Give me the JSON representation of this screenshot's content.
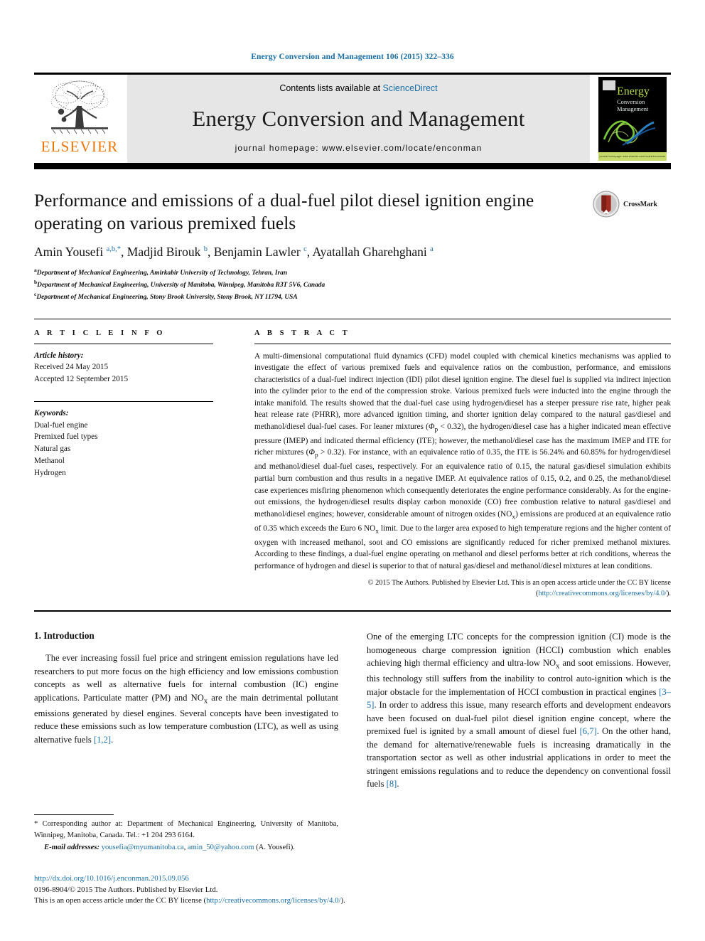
{
  "running_head": "Energy Conversion and Management 106 (2015) 322–336",
  "masthead": {
    "publisher_name": "ELSEVIER",
    "contents_prefix": "Contents lists available at ",
    "contents_link": "ScienceDirect",
    "journal_title": "Energy Conversion and Management",
    "homepage": "journal homepage: www.elsevier.com/locate/enconman",
    "cover": {
      "title": "Energy",
      "subtitle_line1": "Conversion",
      "subtitle_line2": "Management",
      "footer_strip": "journal homepage: www.elsevier.com/locate/enconman"
    }
  },
  "article": {
    "title": "Performance and emissions of a dual-fuel pilot diesel ignition engine operating on various premixed fuels",
    "crossmark_label": "CrossMark",
    "authors_html": "Amin Yousefi <sup>a,b,*</sup>, Madjid Birouk <sup>b</sup>, Benjamin Lawler <sup>c</sup>, Ayatallah Gharehghani <sup>a</sup>",
    "affiliations": [
      "Department of Mechanical Engineering, Amirkabir University of Technology, Tehran, Iran",
      "Department of Mechanical Engineering, University of Manitoba, Winnipeg, Manitoba R3T 5V6, Canada",
      "Department of Mechanical Engineering, Stony Brook University, Stony Brook, NY 11794, USA"
    ],
    "affiliation_marks": [
      "a",
      "b",
      "c"
    ]
  },
  "article_info": {
    "heading": "A R T I C L E    I N F O",
    "history_label": "Article history:",
    "history": [
      "Received 24 May 2015",
      "Accepted 12 September 2015"
    ],
    "keywords_label": "Keywords:",
    "keywords": [
      "Dual-fuel engine",
      "Premixed fuel types",
      "Natural gas",
      "Methanol",
      "Hydrogen"
    ]
  },
  "abstract": {
    "heading": "A B S T R A C T",
    "text": "A multi-dimensional computational fluid dynamics (CFD) model coupled with chemical kinetics mechanisms was applied to investigate the effect of various premixed fuels and equivalence ratios on the combustion, performance, and emissions characteristics of a dual-fuel indirect injection (IDI) pilot diesel ignition engine. The diesel fuel is supplied via indirect injection into the cylinder prior to the end of the compression stroke. Various premixed fuels were inducted into the engine through the intake manifold. The results showed that the dual-fuel case using hydrogen/diesel has a steeper pressure rise rate, higher peak heat release rate (PHRR), more advanced ignition timing, and shorter ignition delay compared to the natural gas/diesel and methanol/diesel dual-fuel cases. For leaner mixtures (Φp < 0.32), the hydrogen/diesel case has a higher indicated mean effective pressure (IMEP) and indicated thermal efficiency (ITE); however, the methanol/diesel case has the maximum IMEP and ITE for richer mixtures (Φp > 0.32). For instance, with an equivalence ratio of 0.35, the ITE is 56.24% and 60.85% for hydrogen/diesel and methanol/diesel dual-fuel cases, respectively. For an equivalence ratio of 0.15, the natural gas/diesel simulation exhibits partial burn combustion and thus results in a negative IMEP. At equivalence ratios of 0.15, 0.2, and 0.25, the methanol/diesel case experiences misfiring phenomenon which consequently deteriorates the engine performance considerably. As for the engine-out emissions, the hydrogen/diesel results display carbon monoxide (CO) free combustion relative to natural gas/diesel and methanol/diesel engines; however, considerable amount of nitrogen oxides (NOx) emissions are produced at an equivalence ratio of 0.35 which exceeds the Euro 6 NOx limit. Due to the larger area exposed to high temperature regions and the higher content of oxygen with increased methanol, soot and CO emissions are significantly reduced for richer premixed methanol mixtures. According to these findings, a dual-fuel engine operating on methanol and diesel performs better at rich conditions, whereas the performance of hydrogen and diesel is superior to that of natural gas/diesel and methanol/diesel mixtures at lean conditions.",
    "copyright_prefix": "© 2015 The Authors. Published by Elsevier Ltd. This is an open access article under the CC BY license (",
    "copyright_link": "http://creativecommons.org/licenses/by/4.0/",
    "copyright_suffix": ")."
  },
  "body": {
    "section_heading": "1. Introduction",
    "left_paragraph": "The ever increasing fossil fuel price and stringent emission regulations have led researchers to put more focus on the high efficiency and low emissions combustion concepts as well as alternative fuels for internal combustion (IC) engine applications. Particulate matter (PM) and NOx are the main detrimental pollutant emissions generated by diesel engines. Several concepts have been investigated to reduce these emissions such as low temperature combustion (LTC), as well as using alternative fuels",
    "left_ref": "[1,2]",
    "right_paragraph_1": "One of the emerging LTC concepts for the compression ignition (CI) mode is the homogeneous charge compression ignition (HCCI) combustion which enables achieving high thermal efficiency and ultra-low NOx and soot emissions. However, this technology still suffers from the inability to control auto-ignition which is the major obstacle for the implementation of HCCI combustion in practical engines",
    "right_ref_1": "[3–5]",
    "right_paragraph_2": ". In order to address this issue, many research efforts and development endeavors have been focused on dual-fuel pilot diesel ignition engine concept, where the premixed fuel is ignited by a small amount of diesel fuel",
    "right_ref_2": "[6,7]",
    "right_paragraph_3": ". On the other hand, the demand for alternative/renewable fuels is increasing dramatically in the transportation sector as well as other industrial applications in order to meet the stringent emissions regulations and to reduce the dependency on conventional fossil fuels",
    "right_ref_3": "[8]"
  },
  "footnote": {
    "star": "*",
    "corresponding": "Corresponding author at: Department of Mechanical Engineering, University of Manitoba, Winnipeg, Manitoba, Canada. Tel.: +1 204 293 6164.",
    "email_label": "E-mail addresses:",
    "email_1": "yousefia@myumanitoba.ca",
    "email_2": "amin_50@yahoo.com",
    "email_attrib": "(A. Yousefi)."
  },
  "footer": {
    "doi": "http://dx.doi.org/10.1016/j.enconman.2015.09.056",
    "issn_line": "0196-8904/© 2015 The Authors. Published by Elsevier Ltd.",
    "license_prefix": "This is an open access article under the CC BY license (",
    "license_link": "http://creativecommons.org/licenses/by/4.0/",
    "license_suffix": ")."
  },
  "colors": {
    "link": "#1a6ea8",
    "elsevier_orange": "#ec7404",
    "masthead_grey": "#e6e6e6",
    "cover_green": "#b9d94a"
  }
}
